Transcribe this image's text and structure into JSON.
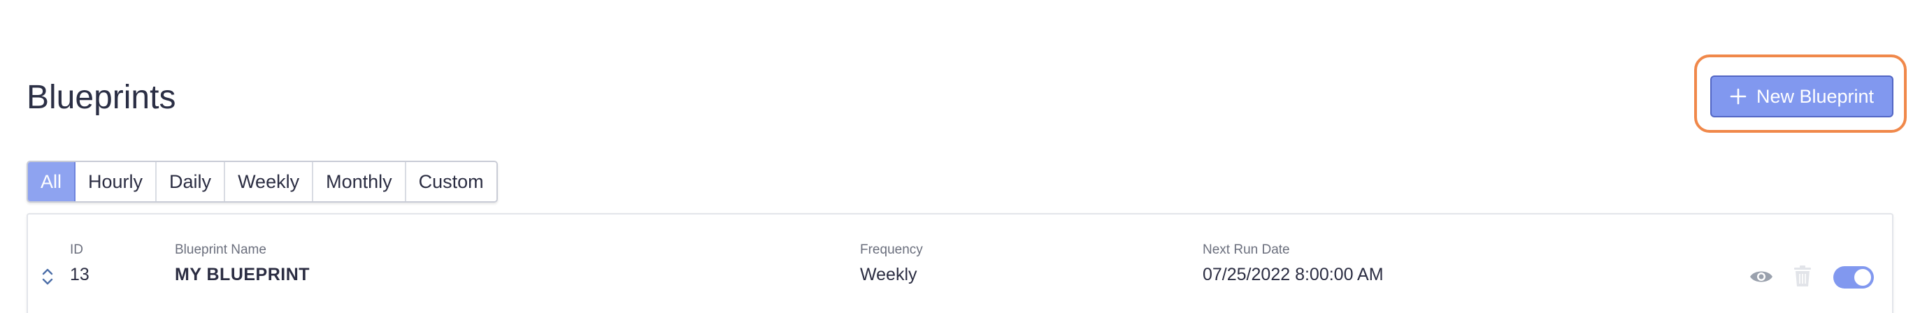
{
  "header": {
    "title": "Blueprints",
    "new_button_label": "New Blueprint"
  },
  "filters": [
    {
      "label": "All",
      "active": true
    },
    {
      "label": "Hourly",
      "active": false
    },
    {
      "label": "Daily",
      "active": false
    },
    {
      "label": "Weekly",
      "active": false
    },
    {
      "label": "Monthly",
      "active": false
    },
    {
      "label": "Custom",
      "active": false
    }
  ],
  "columns": {
    "id": "ID",
    "name": "Blueprint Name",
    "frequency": "Frequency",
    "next_run": "Next Run Date"
  },
  "rows": [
    {
      "id": "13",
      "name": "MY BLUEPRINT",
      "frequency": "Weekly",
      "next_run": "07/25/2022 8:00:00 AM",
      "enabled": true
    }
  ],
  "icons": {
    "new": "plus-icon",
    "sort": "sort-icon",
    "view": "eye-icon",
    "delete": "trash-icon"
  },
  "colors": {
    "accent": "#8198ef",
    "highlight": "#f0884a",
    "text": "#2b2d42"
  }
}
